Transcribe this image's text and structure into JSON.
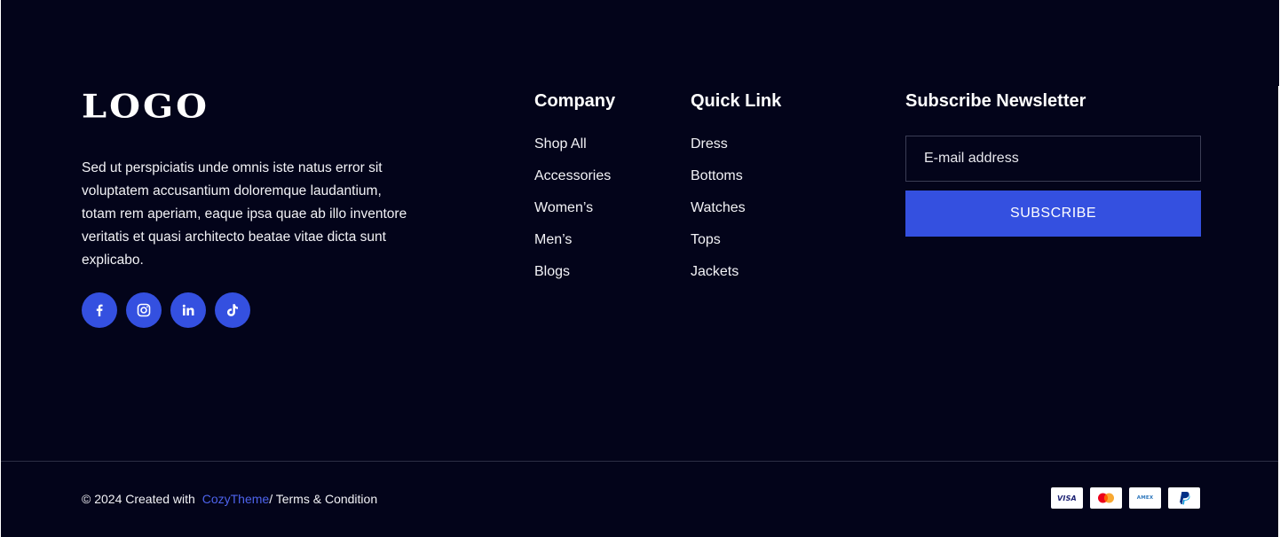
{
  "brand": {
    "logo_text": "LOGO",
    "description": "Sed ut perspiciatis unde omnis iste natus error sit voluptatem accusantium doloremque laudantium, totam rem aperiam, eaque ipsa quae ab illo inventore veritatis et quasi architecto beatae vitae dicta sunt explicabo."
  },
  "socials": [
    {
      "icon": "facebook-icon"
    },
    {
      "icon": "instagram-icon"
    },
    {
      "icon": "linkedin-icon"
    },
    {
      "icon": "tiktok-icon"
    }
  ],
  "company": {
    "title": "Company",
    "links": [
      "Shop All",
      "Accessories",
      "Women’s",
      "Men’s",
      "Blogs"
    ]
  },
  "quick_link": {
    "title": "Quick Link",
    "links": [
      "Dress",
      "Bottoms",
      "Watches",
      "Tops",
      "Jackets"
    ]
  },
  "newsletter": {
    "title": "Subscribe Newsletter",
    "email_placeholder": "E-mail address",
    "button_label": "SUBSCRIBE"
  },
  "bottom": {
    "copyright_prefix": "© 2024 Created with",
    "brand_link": "CozyTheme",
    "terms_link": "/ Terms & Condition"
  },
  "payments": [
    {
      "icon": "visa-icon",
      "label": "VISA"
    },
    {
      "icon": "mastercard-icon"
    },
    {
      "icon": "amex-icon",
      "label": "AMEX"
    },
    {
      "icon": "paypal-icon"
    }
  ],
  "colors": {
    "background": "#03041a",
    "accent": "#3450e0",
    "link_accent": "#4d63ec"
  }
}
